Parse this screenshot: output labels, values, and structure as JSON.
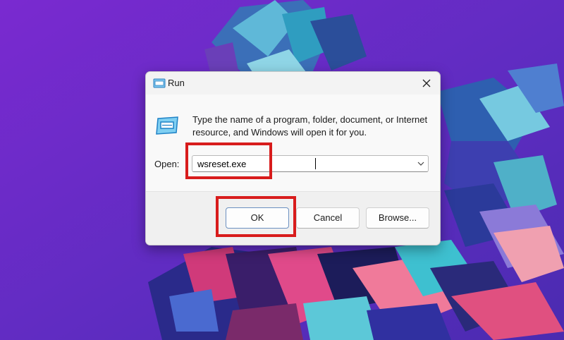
{
  "dialog": {
    "title": "Run",
    "description": "Type the name of a program, folder, document, or Internet resource, and Windows will open it for you.",
    "open_label": "Open:",
    "open_value": "wsreset.exe",
    "buttons": {
      "ok": "OK",
      "cancel": "Cancel",
      "browse": "Browse..."
    }
  },
  "colors": {
    "wallpaper_base": "#6a2cc2",
    "highlight": "#d81c1c",
    "accent": "#0b63b5"
  },
  "icons": [
    "run-icon",
    "close-icon",
    "chevron-down-icon"
  ]
}
